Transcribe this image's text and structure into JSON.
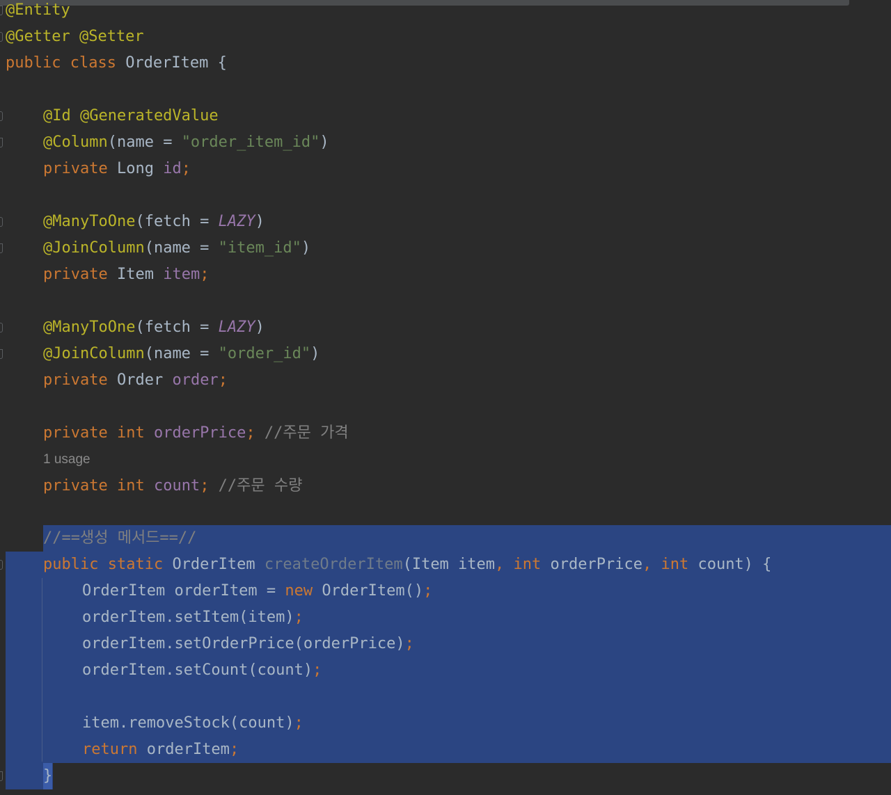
{
  "editor": {
    "lines": {
      "l1": {
        "a": "@Entity"
      },
      "l2": {
        "a": "@Getter @Setter"
      },
      "l3": {
        "kw": "public class ",
        "name": "OrderItem {"
      },
      "l5": {
        "a": "@Id @GeneratedValue"
      },
      "l6": {
        "a": "@Column",
        "p1": "(name = ",
        "s": "\"order_item_id\"",
        "p2": ")"
      },
      "l7": {
        "kw": "private ",
        "t": "Long ",
        "f": "id",
        "semi": ";"
      },
      "l9": {
        "a": "@ManyToOne",
        "p1": "(fetch = ",
        "i": "LAZY",
        "p2": ")"
      },
      "l10": {
        "a": "@JoinColumn",
        "p1": "(name = ",
        "s": "\"item_id\"",
        "p2": ")"
      },
      "l11": {
        "kw": "private ",
        "t": "Item ",
        "f": "item",
        "semi": ";"
      },
      "l13": {
        "a": "@ManyToOne",
        "p1": "(fetch = ",
        "i": "LAZY",
        "p2": ")"
      },
      "l14": {
        "a": "@JoinColumn",
        "p1": "(name = ",
        "s": "\"order_id\"",
        "p2": ")"
      },
      "l15": {
        "kw": "private ",
        "t": "Order ",
        "f": "order",
        "semi": ";"
      },
      "l17": {
        "kw": "private int ",
        "f": "orderPrice",
        "semi": ";",
        "c": " //주문 가격"
      },
      "usage": "1 usage",
      "l18": {
        "kw": "private int ",
        "f": "count",
        "semi": ";",
        "c": " //주문 수량"
      },
      "l20": {
        "c": "//==생성 메서드==//"
      },
      "l21": {
        "kw": "public static ",
        "t": "OrderItem ",
        "m": "createOrderItem",
        "p1": "(Item item",
        "comma1": ", ",
        "kw2": "int ",
        "p2": "orderPrice",
        "comma2": ", ",
        "kw3": "int ",
        "p3": "count) {"
      },
      "l22": {
        "t": "OrderItem orderItem = ",
        "kw": "new ",
        "p": "OrderItem()",
        "semi": ";"
      },
      "l23": {
        "p": "orderItem.setItem(item)",
        "semi": ";"
      },
      "l24": {
        "p": "orderItem.setOrderPrice(orderPrice)",
        "semi": ";"
      },
      "l25": {
        "p": "orderItem.setCount(count)",
        "semi": ";"
      },
      "l27": {
        "p": "item.removeStock(count)",
        "semi": ";"
      },
      "l28": {
        "kw": "return ",
        "p": "orderItem",
        "semi": ";"
      },
      "l29": {
        "p": "}"
      }
    }
  }
}
